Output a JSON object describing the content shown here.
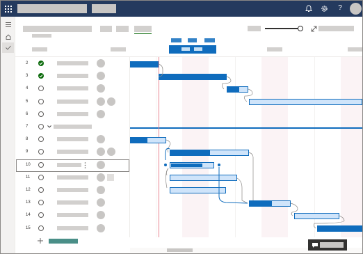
{
  "top_bar": {
    "icons": [
      "app-launcher-icon",
      "bell-icon",
      "gear-icon",
      "help-icon",
      "avatar"
    ]
  },
  "rail": {
    "icons": [
      "menu-icon",
      "home-icon",
      "check-icon"
    ]
  },
  "task_rows": [
    {
      "num": "2",
      "status": "done"
    },
    {
      "num": "3",
      "status": "done"
    },
    {
      "num": "4",
      "status": "open"
    },
    {
      "num": "5",
      "status": "open"
    },
    {
      "num": "6",
      "status": "open"
    },
    {
      "num": "7",
      "status": "group"
    },
    {
      "num": "8",
      "status": "open"
    },
    {
      "num": "9",
      "status": "open"
    },
    {
      "num": "10",
      "status": "open"
    },
    {
      "num": "11",
      "status": "open"
    },
    {
      "num": "12",
      "status": "open"
    },
    {
      "num": "13",
      "status": "open"
    },
    {
      "num": "14",
      "status": "open"
    },
    {
      "num": "15",
      "status": "open"
    }
  ],
  "add_task": {
    "icon": "plus-icon"
  },
  "colors": {
    "topbar": "#243a5e",
    "accent": "#0f6cbd",
    "bar_light": "#cfe4fa",
    "today_line": "#e8838f",
    "done_green": "#0b6a0b",
    "add_button": "#4a8f88"
  },
  "chat_button": {
    "icon": "chat-icon"
  }
}
